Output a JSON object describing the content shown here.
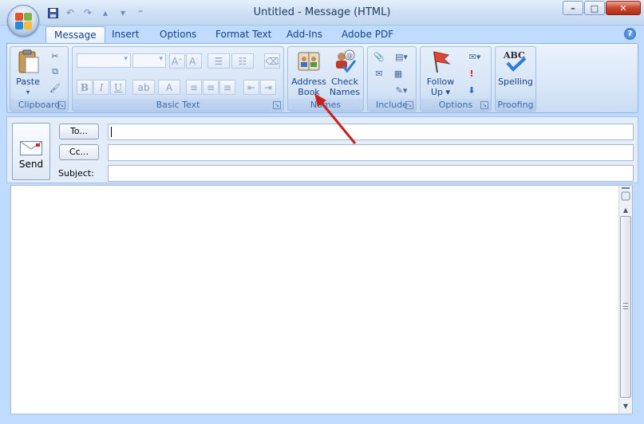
{
  "window": {
    "title": "Untitled - Message (HTML)",
    "minimize": "–",
    "maximize": "□",
    "close": "✕"
  },
  "tabs": [
    "Message",
    "Insert",
    "Options",
    "Format Text",
    "Add-Ins",
    "Adobe PDF"
  ],
  "help": "?",
  "groups": {
    "clipboard": {
      "label": "Clipboard",
      "paste": "Paste"
    },
    "basic_text": {
      "label": "Basic Text"
    },
    "names": {
      "label": "Names",
      "address_book": [
        "Address",
        "Book"
      ],
      "check_names": [
        "Check",
        "Names"
      ]
    },
    "include": {
      "label": "Include"
    },
    "options": {
      "label": "Options",
      "follow_up": [
        "Follow",
        "Up ▾"
      ]
    },
    "proofing": {
      "label": "Proofing",
      "spelling": "Spelling",
      "abc": "ABC"
    }
  },
  "format_buttons": [
    "B",
    "I",
    "U"
  ],
  "header": {
    "send": "Send",
    "to_button": "To...",
    "cc_button": "Cc...",
    "subject_label": "Subject:",
    "to_value": "",
    "cc_value": "",
    "subject_value": ""
  },
  "colors": {
    "accent": "#15428b",
    "annotation_arrow": "#cc1f1f"
  }
}
